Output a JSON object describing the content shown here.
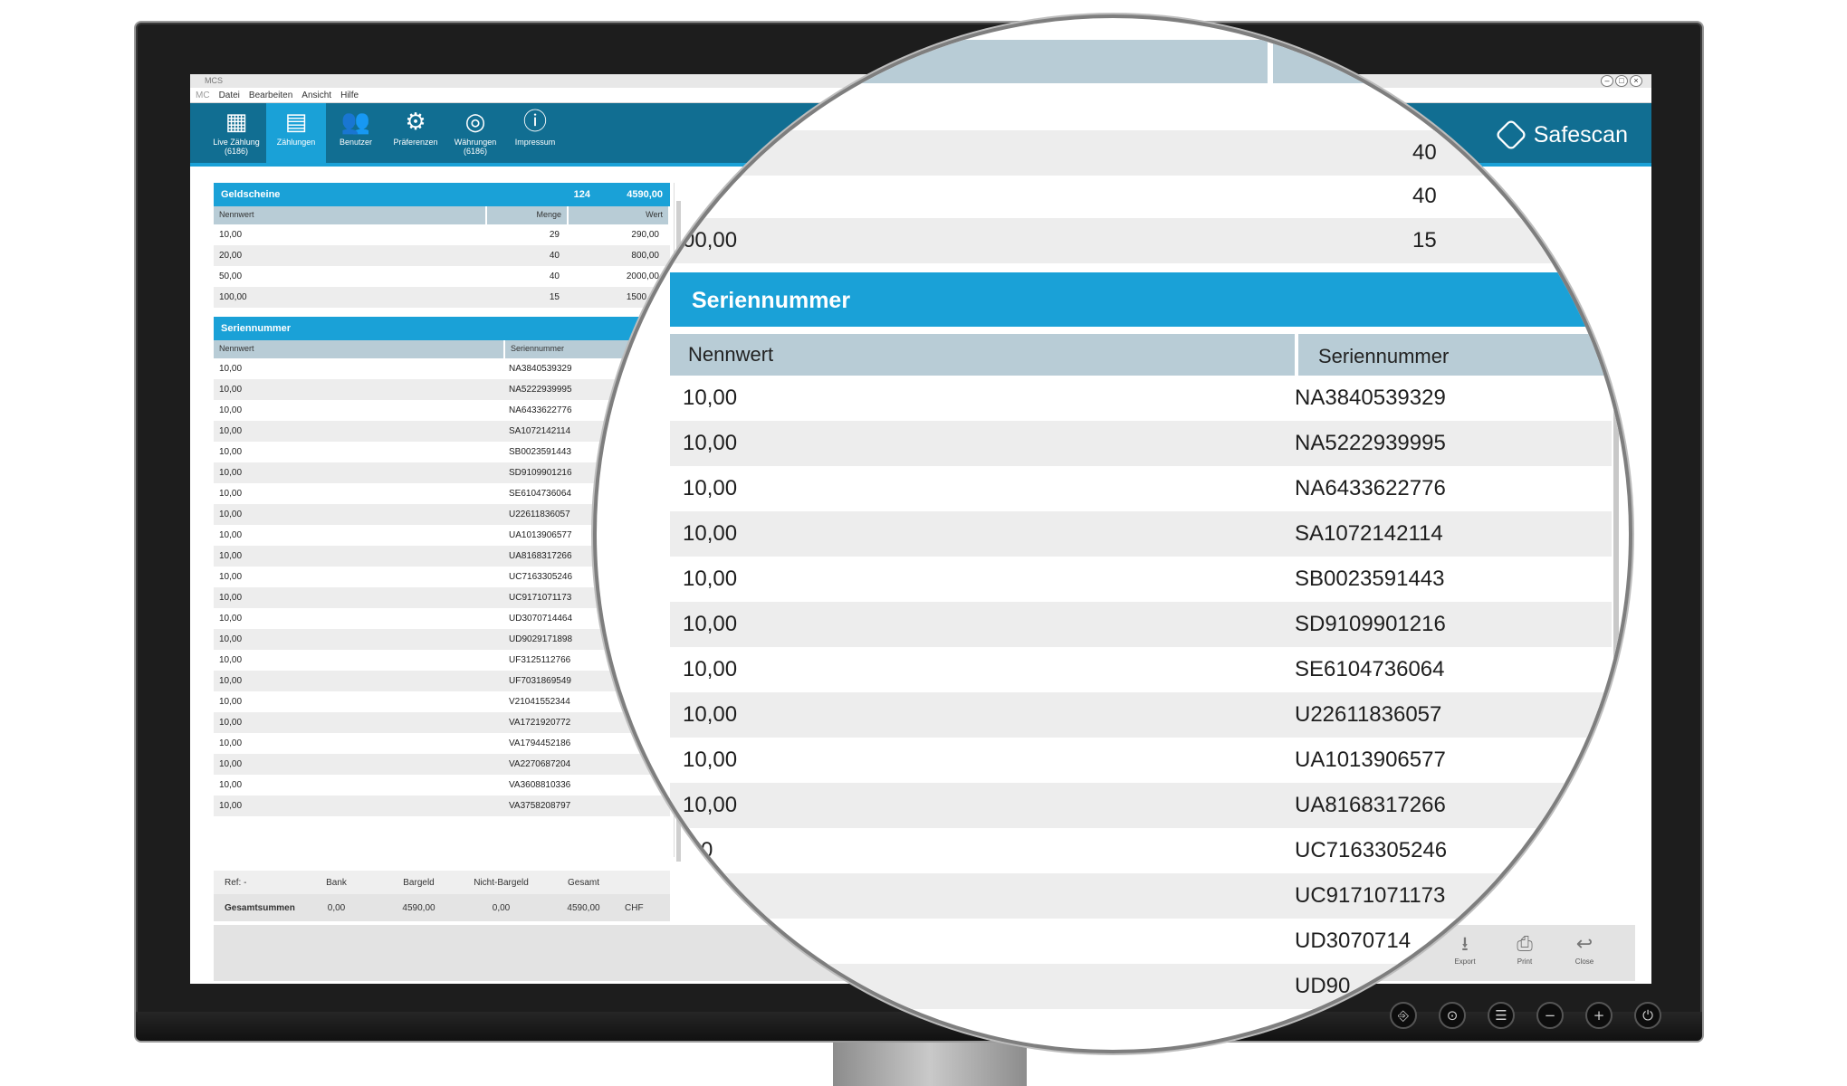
{
  "window": {
    "title": "MCS",
    "controls": [
      "–",
      "□",
      "×"
    ]
  },
  "menu": {
    "app_label": "MC",
    "items": [
      "Datei",
      "Bearbeiten",
      "Ansicht",
      "Hilfe"
    ]
  },
  "ribbon": {
    "items": [
      {
        "label": "Live Zählung (6186)",
        "icon": "calculator-clock-icon",
        "glyph": "▦"
      },
      {
        "label": "Zählungen",
        "icon": "calculator-plus-icon",
        "glyph": "▤",
        "active": true
      },
      {
        "label": "Benutzer",
        "icon": "users-icon",
        "glyph": "👥"
      },
      {
        "label": "Präferenzen",
        "icon": "gears-icon",
        "glyph": "⚙"
      },
      {
        "label": "Währungen (6186)",
        "icon": "coins-icon",
        "glyph": "◎"
      },
      {
        "label": "Impressum",
        "icon": "info-icon",
        "glyph": "ⓘ"
      }
    ],
    "brand": "Safescan"
  },
  "banknotes": {
    "title": "Geldscheine",
    "count": "124",
    "total": "4590,00",
    "columns": [
      "Nennwert",
      "Menge",
      "Wert"
    ],
    "rows": [
      [
        "10,00",
        "29",
        "290,00"
      ],
      [
        "20,00",
        "40",
        "800,00"
      ],
      [
        "50,00",
        "40",
        "2000,00"
      ],
      [
        "100,00",
        "15",
        "1500,00"
      ]
    ]
  },
  "serials": {
    "title": "Seriennummer",
    "columns": [
      "Nennwert",
      "Seriennummer"
    ],
    "rows": [
      [
        "10,00",
        "NA3840539329"
      ],
      [
        "10,00",
        "NA5222939995"
      ],
      [
        "10,00",
        "NA6433622776"
      ],
      [
        "10,00",
        "SA1072142114"
      ],
      [
        "10,00",
        "SB0023591443"
      ],
      [
        "10,00",
        "SD9109901216"
      ],
      [
        "10,00",
        "SE6104736064"
      ],
      [
        "10,00",
        "U22611836057"
      ],
      [
        "10,00",
        "UA1013906577"
      ],
      [
        "10,00",
        "UA8168317266"
      ],
      [
        "10,00",
        "UC7163305246"
      ],
      [
        "10,00",
        "UC9171071173"
      ],
      [
        "10,00",
        "UD3070714464"
      ],
      [
        "10,00",
        "UD9029171898"
      ],
      [
        "10,00",
        "UF3125112766"
      ],
      [
        "10,00",
        "UF7031869549"
      ],
      [
        "10,00",
        "V21041552344"
      ],
      [
        "10,00",
        "VA1721920772"
      ],
      [
        "10,00",
        "VA1794452186"
      ],
      [
        "10,00",
        "VA2270687204"
      ],
      [
        "10,00",
        "VA3608810336"
      ],
      [
        "10,00",
        "VA3758208797"
      ]
    ]
  },
  "totals": {
    "ref": "Ref: -",
    "headers": [
      "Bank",
      "Bargeld",
      "Nicht-Bargeld",
      "Gesamt"
    ],
    "label": "Gesamtsummen",
    "values": [
      "0,00",
      "4590,00",
      "0,00",
      "4590,00"
    ],
    "currency": "CHF"
  },
  "footer": {
    "buttons": [
      {
        "label": "Export",
        "icon": "export-icon",
        "glyph": "⭳"
      },
      {
        "label": "Print",
        "icon": "printer-icon",
        "glyph": "⎙"
      },
      {
        "label": "Close",
        "icon": "close-arrow-icon",
        "glyph": "↩"
      }
    ]
  },
  "magnifier": {
    "top_rows": [
      [
        "",
        "40"
      ],
      [
        "0",
        "40"
      ],
      [
        "00,00",
        "15"
      ]
    ],
    "title": "Seriennummer",
    "columns": [
      "Nennwert",
      "Seriennummer"
    ],
    "rows": [
      [
        "10,00",
        "NA3840539329"
      ],
      [
        "10,00",
        "NA5222939995"
      ],
      [
        "10,00",
        "NA6433622776"
      ],
      [
        "10,00",
        "SA1072142114"
      ],
      [
        "10,00",
        "SB0023591443"
      ],
      [
        "10,00",
        "SD9109901216"
      ],
      [
        "10,00",
        "SE6104736064"
      ],
      [
        "10,00",
        "U22611836057"
      ],
      [
        "10,00",
        "UA1013906577"
      ],
      [
        "10,00",
        "UA8168317266"
      ],
      [
        ",00",
        "UC7163305246"
      ],
      [
        "",
        "UC9171071173"
      ],
      [
        "",
        "UD3070714"
      ],
      [
        "",
        "UD90"
      ]
    ]
  },
  "monitor": {
    "buttons": [
      "⎆",
      "⊙",
      "☰",
      "−",
      "+",
      "⏻"
    ]
  }
}
